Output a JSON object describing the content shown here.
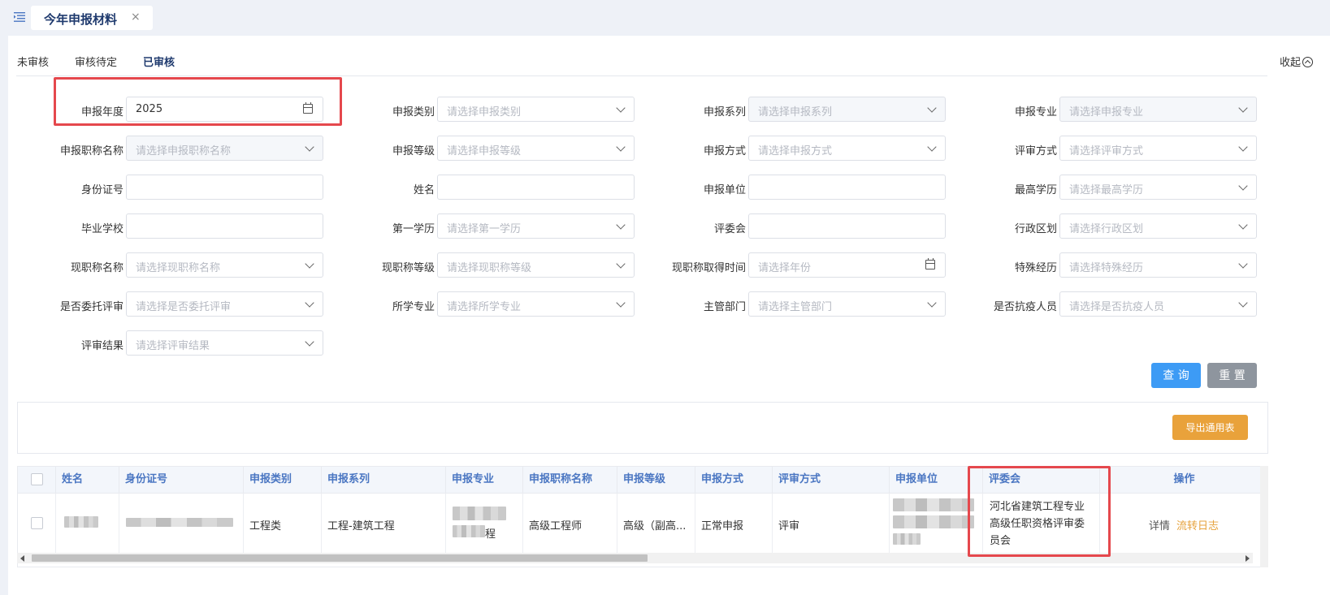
{
  "tab": {
    "label": "今年申报材料",
    "close": "×"
  },
  "subtabs": [
    "未审核",
    "审核待定",
    "已审核"
  ],
  "collapse_label": "收起",
  "filters": [
    {
      "label": "申报年度",
      "value": "2025",
      "placeholder": "",
      "type": "date"
    },
    {
      "label": "申报类别",
      "value": "",
      "placeholder": "请选择申报类别",
      "type": "select"
    },
    {
      "label": "申报系列",
      "value": "",
      "placeholder": "请选择申报系列",
      "type": "select-disabled"
    },
    {
      "label": "申报专业",
      "value": "",
      "placeholder": "请选择申报专业",
      "type": "select-disabled"
    },
    {
      "label": "申报职称名称",
      "value": "",
      "placeholder": "请选择申报职称名称",
      "type": "select-disabled"
    },
    {
      "label": "申报等级",
      "value": "",
      "placeholder": "请选择申报等级",
      "type": "select"
    },
    {
      "label": "申报方式",
      "value": "",
      "placeholder": "请选择申报方式",
      "type": "select"
    },
    {
      "label": "评审方式",
      "value": "",
      "placeholder": "请选择评审方式",
      "type": "select"
    },
    {
      "label": "身份证号",
      "value": "",
      "placeholder": "",
      "type": "input"
    },
    {
      "label": "姓名",
      "value": "",
      "placeholder": "",
      "type": "input"
    },
    {
      "label": "申报单位",
      "value": "",
      "placeholder": "",
      "type": "input"
    },
    {
      "label": "最高学历",
      "value": "",
      "placeholder": "请选择最高学历",
      "type": "select"
    },
    {
      "label": "毕业学校",
      "value": "",
      "placeholder": "",
      "type": "input"
    },
    {
      "label": "第一学历",
      "value": "",
      "placeholder": "请选择第一学历",
      "type": "select"
    },
    {
      "label": "评委会",
      "value": "",
      "placeholder": "",
      "type": "input"
    },
    {
      "label": "行政区划",
      "value": "",
      "placeholder": "请选择行政区划",
      "type": "select"
    },
    {
      "label": "现职称名称",
      "value": "",
      "placeholder": "请选择现职称名称",
      "type": "select"
    },
    {
      "label": "现职称等级",
      "value": "",
      "placeholder": "请选择现职称等级",
      "type": "select"
    },
    {
      "label": "现职称取得时间",
      "value": "",
      "placeholder": "请选择年份",
      "type": "date"
    },
    {
      "label": "特殊经历",
      "value": "",
      "placeholder": "请选择特殊经历",
      "type": "select"
    },
    {
      "label": "是否委托评审",
      "value": "",
      "placeholder": "请选择是否委托评审",
      "type": "select"
    },
    {
      "label": "所学专业",
      "value": "",
      "placeholder": "请选择所学专业",
      "type": "select"
    },
    {
      "label": "主管部门",
      "value": "",
      "placeholder": "请选择主管部门",
      "type": "select"
    },
    {
      "label": "是否抗疫人员",
      "value": "",
      "placeholder": "请选择是否抗疫人员",
      "type": "select"
    },
    {
      "label": "评审结果",
      "value": "",
      "placeholder": "请选择评审结果",
      "type": "select"
    }
  ],
  "buttons": {
    "query": "查 询",
    "reset": "重 置",
    "export": "导出通用表"
  },
  "table": {
    "headers": [
      "姓名",
      "身份证号",
      "申报类别",
      "申报系列",
      "申报专业",
      "申报职称名称",
      "申报等级",
      "申报方式",
      "评审方式",
      "申报单位",
      "评委会",
      "操作"
    ],
    "row": {
      "category": "工程类",
      "series": "工程-建筑工程",
      "specialty_visible": "程",
      "title_name": "高级工程师",
      "level": "高级（副高...",
      "method": "正常申报",
      "review_method": "评审",
      "committee": "河北省建筑工程专业高级任职资格评审委员会",
      "actions": [
        "详情",
        "流转日志"
      ]
    }
  },
  "colors": {
    "accent": "#3d9bf5",
    "export": "#e9a23b",
    "highlight": "#e5484d",
    "header_text": "#4a76c2"
  }
}
